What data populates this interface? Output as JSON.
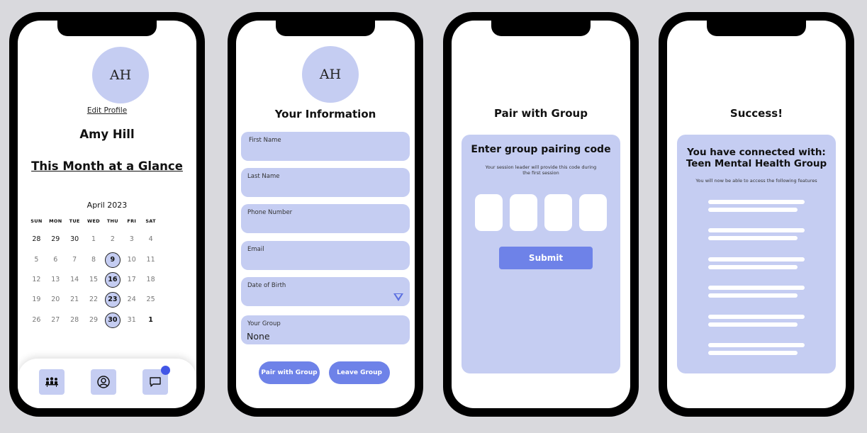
{
  "profile": {
    "initials": "AH",
    "edit_link": "Edit Profile",
    "name": "Amy Hill",
    "glance_heading": "This Month at a Glance",
    "calendar": {
      "month_label": "April 2023",
      "weekdays": [
        "SUN",
        "MON",
        "TUE",
        "WED",
        "THU",
        "FRI",
        "SAT"
      ],
      "weeks": [
        [
          "28",
          "29",
          "30",
          "1",
          "2",
          "3",
          "4"
        ],
        [
          "5",
          "6",
          "7",
          "8",
          "9",
          "10",
          "11"
        ],
        [
          "12",
          "13",
          "14",
          "15",
          "16",
          "17",
          "18"
        ],
        [
          "19",
          "20",
          "21",
          "22",
          "23",
          "24",
          "25"
        ],
        [
          "26",
          "27",
          "28",
          "29",
          "30",
          "31",
          "1"
        ]
      ],
      "highlighted_days": [
        "9",
        "16",
        "23",
        "30"
      ]
    },
    "nav": {
      "items": [
        "group-icon",
        "profile-icon",
        "chat-icon"
      ],
      "chat_has_notification": true
    }
  },
  "info": {
    "initials": "AH",
    "title": "Your Information",
    "fields": {
      "first_name": "First Name",
      "last_name": "Last Name",
      "phone": "Phone Number",
      "email": "Email",
      "dob": "Date of Birth",
      "group_label": "Your Group",
      "group_value": "None"
    },
    "pair_button": "Pair with Group",
    "leave_button": "Leave Group"
  },
  "pair": {
    "title": "Pair with Group",
    "card_title": "Enter group pairing code",
    "card_subtitle": "Your session leader will provide this code during the first session",
    "submit": "Submit"
  },
  "success": {
    "title": "Success!",
    "heading_line1": "You have connected with:",
    "heading_line2": "Teen Mental Health Group",
    "note": "You will now be able to access the following features"
  },
  "colors": {
    "accent": "#6e82e8",
    "light": "#c5cdf2",
    "badge": "#4256e6",
    "phone_frame": "#000000",
    "background": "#d9d9dd"
  }
}
